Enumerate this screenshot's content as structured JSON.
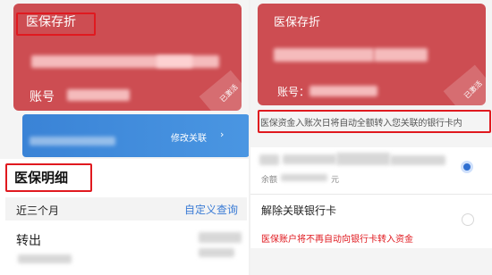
{
  "left": {
    "card": {
      "title": "医保存折",
      "account_label": "账号",
      "stamp": "已激活"
    },
    "blue_banner": {
      "text": "医保资金...",
      "button": "修改关联"
    },
    "details": {
      "title": "医保明细",
      "period": "近三个月",
      "custom_query": "自定义查询",
      "row1": "转出"
    }
  },
  "right": {
    "card": {
      "title": "医保存折",
      "account_label": "账号：",
      "stamp": "已激活"
    },
    "notice": "医保资金入账次日将自动全额转入您关联的银行卡内",
    "bank_option": {
      "balance_label": "余额",
      "balance_unit": "元"
    },
    "unlink": {
      "label": "解除关联银行卡",
      "warning": "医保账户将不再自动向银行卡转入资金"
    }
  },
  "colors": {
    "card_red": "#cd4d52",
    "annotation_red": "#e0191f",
    "link_blue": "#3a7bd5",
    "radio_blue": "#2f6fd1"
  }
}
